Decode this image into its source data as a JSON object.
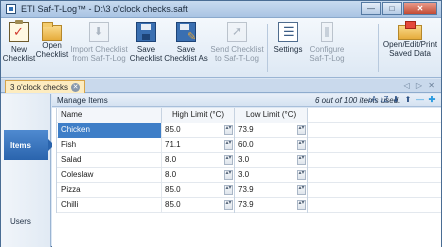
{
  "window": {
    "title": "ETI Saf-T-Log™ - D:\\3 o'clock checks.saft",
    "minimize": "—",
    "maximize": "□",
    "close": "✕"
  },
  "ribbon": {
    "buttons": [
      {
        "label1": "New",
        "label2": "Checklist",
        "icon": "new-checklist-icon",
        "enabled": true
      },
      {
        "label1": "Open",
        "label2": "Checklist",
        "icon": "open-folder-icon",
        "enabled": true
      },
      {
        "label1": "Import Checklist",
        "label2": "from Saf-T-Log",
        "icon": "import-icon",
        "enabled": false
      },
      {
        "label1": "Save",
        "label2": "Checklist",
        "icon": "save-disk-icon",
        "enabled": true
      },
      {
        "label1": "Save",
        "label2": "Checklist As",
        "icon": "save-as-icon",
        "enabled": true
      },
      {
        "label1": "Send Checklist",
        "label2": "to Saf-T-Log",
        "icon": "send-icon",
        "enabled": false
      },
      {
        "label1": "Settings",
        "label2": "",
        "icon": "settings-icon",
        "enabled": true
      },
      {
        "label1": "Configure",
        "label2": "Saf-T-Log",
        "icon": "configure-device-icon",
        "enabled": false
      },
      {
        "label1": "Open/Edit/Print",
        "label2": "Saved Data",
        "icon": "print-folder-icon",
        "enabled": true
      }
    ]
  },
  "doc_tab": {
    "label": "3 o'clock checks",
    "close": "✕"
  },
  "tab_nav": "◁ ▷ ✕",
  "nav": {
    "items": [
      {
        "label": "Items",
        "active": true
      },
      {
        "label": "Users",
        "active": false
      }
    ]
  },
  "panel": {
    "title": "Manage Items",
    "usage": "6 out of 100 items used.",
    "tools": {
      "sort_az": "↓A",
      "sort_za": "↓Z",
      "down": "⬇",
      "up": "⬆",
      "remove": "—",
      "add": "✚"
    }
  },
  "grid": {
    "columns": [
      "Name",
      "High Limit (°C)",
      "Low Limit (°C)"
    ],
    "rows": [
      {
        "name": "Chicken",
        "high": "85.0",
        "low": "73.9",
        "selected": true
      },
      {
        "name": "Fish",
        "high": "71.1",
        "low": "60.0",
        "selected": false
      },
      {
        "name": "Salad",
        "high": "8.0",
        "low": "3.0",
        "selected": false
      },
      {
        "name": "Coleslaw",
        "high": "8.0",
        "low": "3.0",
        "selected": false
      },
      {
        "name": "Pizza",
        "high": "85.0",
        "low": "73.9",
        "selected": false
      },
      {
        "name": "Chilli",
        "high": "85.0",
        "low": "73.9",
        "selected": false
      }
    ],
    "spinner_glyph": "▴▾"
  }
}
